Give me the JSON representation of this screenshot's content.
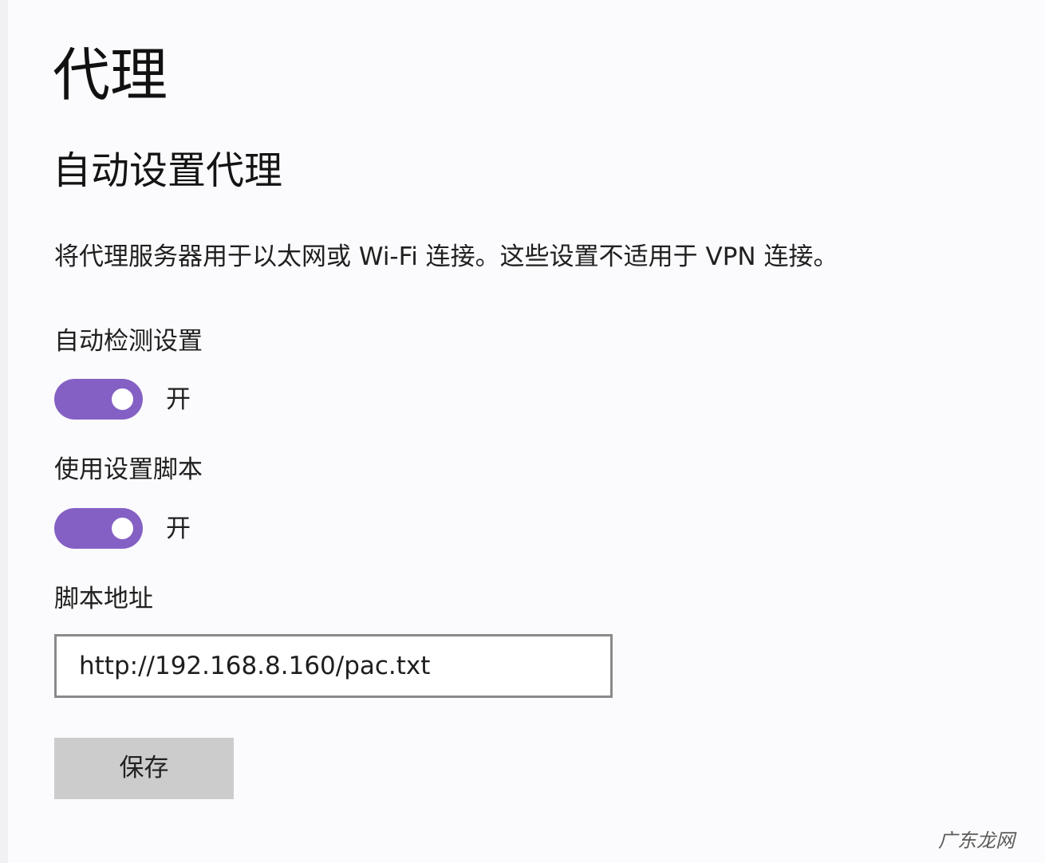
{
  "page": {
    "title": "代理"
  },
  "auto_proxy": {
    "section_title": "自动设置代理",
    "description": "将代理服务器用于以太网或 Wi-Fi 连接。这些设置不适用于 VPN 连接。",
    "auto_detect": {
      "label": "自动检测设置",
      "state": "开",
      "on": true
    },
    "use_script": {
      "label": "使用设置脚本",
      "state": "开",
      "on": true
    },
    "script_address": {
      "label": "脚本地址",
      "value": "http://192.168.8.160/pac.txt"
    },
    "save_label": "保存"
  },
  "watermark": "广东龙网",
  "colors": {
    "toggle_on": "#8460c4",
    "background": "#fbfafc",
    "button_bg": "#cccccc",
    "field_border": "#8a8a8a"
  }
}
